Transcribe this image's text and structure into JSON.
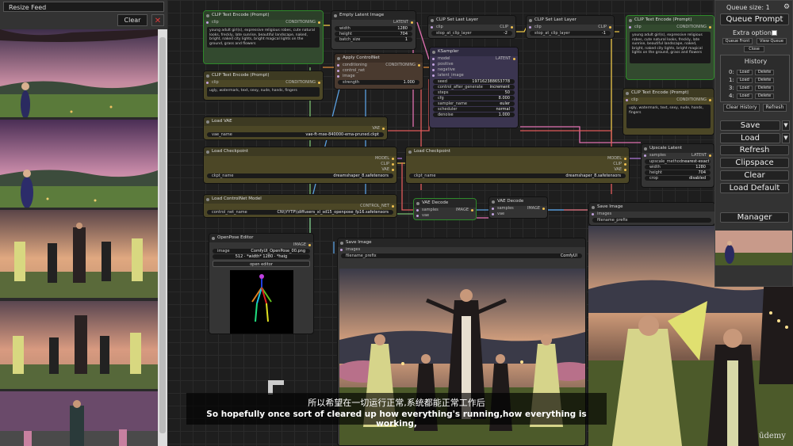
{
  "feed": {
    "resize_label": "Resize Feed",
    "clear_label": "Clear",
    "close_glyph": "✕"
  },
  "nodes": {
    "clip_top": {
      "title": "CLIP Text Encode (Prompt)",
      "in": "clip",
      "out": "CONDITIONING",
      "text": "young adult girl(s), expressive religious robes, cute natural looks, freckly, late sunrise, beautiful landscape, naked, bright, naked city lights, bright magical lights on the ground, grass and flowers"
    },
    "empty_latent": {
      "title": "Empty Latent Image",
      "out": "LATENT",
      "w_label": "width",
      "w_val": "1280",
      "h_label": "height",
      "h_val": "704",
      "b_label": "batch_size",
      "b_val": "1"
    },
    "clip_set_last_1": {
      "title": "CLIP Set Last Layer",
      "in": "clip",
      "out": "CLIP",
      "w_label": "stop_at_clip_layer",
      "w_val": "-2"
    },
    "clip_set_last_2": {
      "title": "CLIP Set Last Layer",
      "in": "clip",
      "out": "CLIP",
      "w_label": "stop_at_clip_layer",
      "w_val": "-1"
    },
    "clip_right_top": {
      "title": "CLIP Text Encode (Prompt)",
      "in": "clip",
      "out": "CONDITIONING",
      "text": "young adult girl(s), expressive religious robes, cute natural looks, freckly, late sunrise, beautiful landscape, naked, bright, naked city lights, bright magical lights on the ground, grass and flowers"
    },
    "clip_neg": {
      "title": "CLIP Text Encode (Prompt)",
      "in": "clip",
      "out": "CONDITIONING",
      "text": "ugly, watermark, text, sexy, nude, hands, fingers"
    },
    "apply_controlnet": {
      "title": "Apply ControlNet",
      "in1": "conditioning",
      "in2": "control_net",
      "in3": "image",
      "out": "CONDITIONING",
      "w_label": "strength",
      "w_val": "1.000"
    },
    "ksampler": {
      "title": "KSampler",
      "in1": "model",
      "in2": "positive",
      "in3": "negative",
      "in4": "latent_image",
      "out": "LATENT",
      "rows": [
        {
          "k": "seed",
          "v": "197162388653778"
        },
        {
          "k": "control_after_generate",
          "v": "increment"
        },
        {
          "k": "steps",
          "v": "50"
        },
        {
          "k": "cfg",
          "v": "8.000"
        },
        {
          "k": "sampler_name",
          "v": "euler"
        },
        {
          "k": "scheduler",
          "v": "normal"
        },
        {
          "k": "denoise",
          "v": "1.000"
        }
      ]
    },
    "clip_right_bottom": {
      "title": "CLIP Text Encode (Prompt)",
      "in": "clip",
      "out": "CONDITIONING",
      "text": "ugly, watermark, text, sexy, nude, hands, fingers"
    },
    "load_vae": {
      "title": "Load VAE",
      "out": "VAE",
      "w_label": "vae_name",
      "w_val": "vae-ft-mse-840000-ema-pruned.ckpt"
    },
    "load_ckpt_1": {
      "title": "Load Checkpoint",
      "o1": "MODEL",
      "o2": "CLIP",
      "o3": "VAE",
      "w_label": "ckpt_name",
      "w_val": "dreamshaper_8.safetensors"
    },
    "load_ckpt_2": {
      "title": "Load Checkpoint",
      "o1": "MODEL",
      "o2": "CLIP",
      "o3": "VAE",
      "w_label": "ckpt_name",
      "w_val": "dreamshaper_8.safetensors"
    },
    "upscale": {
      "title": "Upscale Latent",
      "in": "samples",
      "out": "LATENT",
      "rows": [
        {
          "k": "upscale_method",
          "v": "nearest-exact"
        },
        {
          "k": "width",
          "v": "1280"
        },
        {
          "k": "height",
          "v": "704"
        },
        {
          "k": "crop",
          "v": "disabled"
        }
      ]
    },
    "load_controlnet": {
      "title": "Load ControlNet Model",
      "out": "CONTROL_NET",
      "w_label": "control_net_name",
      "w_val": "CN\\\\YYTP\\\\diffusers_xl_sd15_openpose_fp16.safetensors"
    },
    "vae_decode_1": {
      "title": "VAE Decode",
      "in1": "samples",
      "in2": "vae",
      "out": "IMAGE"
    },
    "vae_decode_2": {
      "title": "VAE Decode",
      "in1": "samples",
      "in2": "vae",
      "out": "IMAGE"
    },
    "save_image_2": {
      "title": "Save Image",
      "in": "images",
      "w_label": "filename_prefix",
      "w_val": ""
    },
    "openpose": {
      "title": "OpenPose Editor",
      "out": "IMAGE",
      "image_label": "image",
      "image_val": "ComfyUI_OpenPose_00.png",
      "dims": "512 · *width* 1280 · *heig",
      "btn": "open editor"
    },
    "save_image_1": {
      "title": "Save Image",
      "in": "images",
      "w_label": "filename_prefix",
      "w_val": "ComfyUI"
    }
  },
  "menu": {
    "queue_size": "Queue size: 1",
    "gear": "⚙",
    "queue_prompt": "Queue Prompt",
    "extra_options": "Extra options",
    "queue_front": "Queue Front",
    "view_queue": "View Queue",
    "close": "Close",
    "history_title": "History",
    "history": [
      {
        "n": "0:",
        "load": "Load",
        "del": "Delete"
      },
      {
        "n": "1:",
        "load": "Load",
        "del": "Delete"
      },
      {
        "n": "3:",
        "load": "Load",
        "del": "Delete"
      },
      {
        "n": "4:",
        "load": "Load",
        "del": "Delete"
      }
    ],
    "clear_history": "Clear History",
    "refresh_history": "Refresh",
    "save": "Save",
    "load": "Load",
    "refresh": "Refresh",
    "clipspace": "Clipspace",
    "clear": "Clear",
    "load_default": "Load Default",
    "manager": "Manager",
    "arrow": "▼"
  },
  "subtitles": {
    "cn": "所以希望在一切运行正常,系统都能正常工作后",
    "en": "So hopefully once sort of cleared up how everything's running,how everything is working,"
  },
  "watermark": "ūdemy",
  "colors": {
    "wire_purple": "#b07ad9",
    "wire_yellow": "#e9c446",
    "wire_red": "#e05a5a",
    "wire_orange": "#e08a3a",
    "wire_blue": "#5aa0e0",
    "wire_pink": "#e070b0",
    "wire_green": "#7ac070",
    "node_green_border": "#2e8a2a"
  }
}
